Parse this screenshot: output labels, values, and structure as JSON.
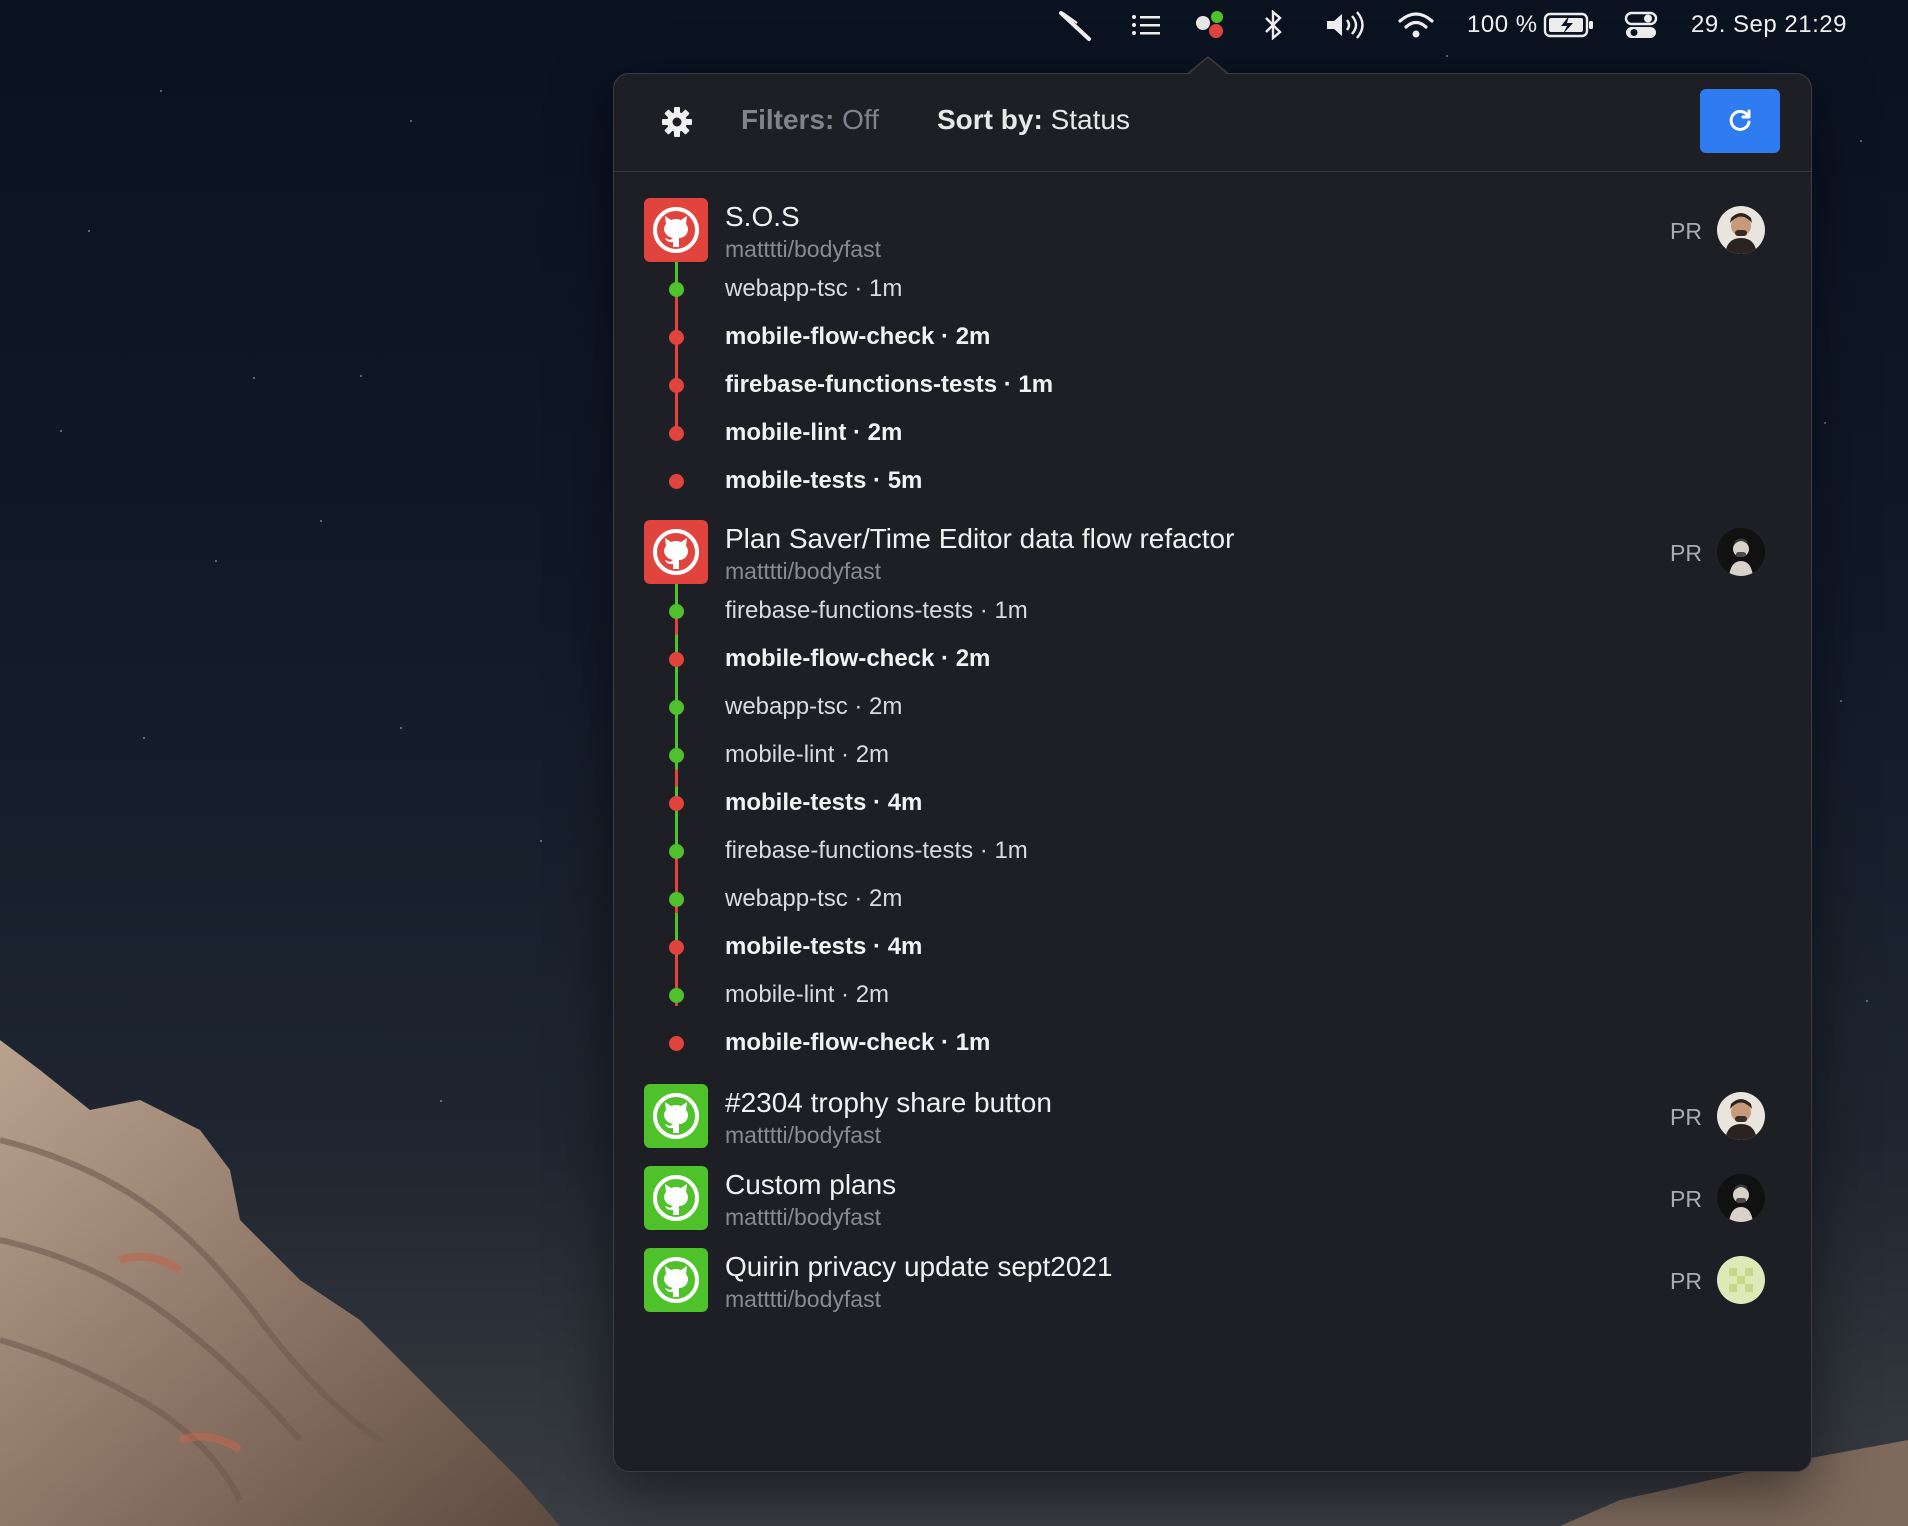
{
  "menubar": {
    "icons": [
      "feather-icon",
      "list-icon",
      "status-dots-icon",
      "bluetooth-icon",
      "volume-icon",
      "wifi-icon",
      "battery-icon",
      "control-center-icon"
    ],
    "battery_label": "100 %",
    "datetime": "29. Sep  21:29"
  },
  "toolbar": {
    "filters_key": "Filters:",
    "filters_value": "Off",
    "sort_key": "Sort by:",
    "sort_value": "Status"
  },
  "colors": {
    "fail": "#e0443d",
    "pass": "#4fc22b",
    "accent": "#2f7bf0"
  },
  "prs": [
    {
      "title": "S.O.S",
      "repo": "matttti/bodyfast",
      "tag": "PR",
      "status": "fail",
      "checks": [
        {
          "label": "webapp-tsc · 1m",
          "status": "pass"
        },
        {
          "label": "mobile-flow-check · 2m",
          "status": "fail"
        },
        {
          "label": "firebase-functions-tests · 1m",
          "status": "fail"
        },
        {
          "label": "mobile-lint · 2m",
          "status": "fail"
        },
        {
          "label": "mobile-tests · 5m",
          "status": "fail"
        }
      ]
    },
    {
      "title": "Plan Saver/Time Editor data flow refactor",
      "repo": "matttti/bodyfast",
      "tag": "PR",
      "status": "fail",
      "checks": [
        {
          "label": "firebase-functions-tests · 1m",
          "status": "pass"
        },
        {
          "label": "mobile-flow-check · 2m",
          "status": "fail"
        },
        {
          "label": "webapp-tsc · 2m",
          "status": "pass"
        },
        {
          "label": "mobile-lint · 2m",
          "status": "pass"
        },
        {
          "label": "mobile-tests · 4m",
          "status": "fail"
        },
        {
          "label": "firebase-functions-tests · 1m",
          "status": "pass"
        },
        {
          "label": "webapp-tsc · 2m",
          "status": "pass"
        },
        {
          "label": "mobile-tests · 4m",
          "status": "fail"
        },
        {
          "label": "mobile-lint · 2m",
          "status": "pass"
        },
        {
          "label": "mobile-flow-check · 1m",
          "status": "fail"
        }
      ]
    },
    {
      "title": "#2304 trophy share button",
      "repo": "matttti/bodyfast",
      "tag": "PR",
      "status": "pass",
      "checks": []
    },
    {
      "title": "Custom plans",
      "repo": "matttti/bodyfast",
      "tag": "PR",
      "status": "pass",
      "checks": []
    },
    {
      "title": "Quirin privacy update sept2021",
      "repo": "matttti/bodyfast",
      "tag": "PR",
      "status": "pass",
      "checks": []
    }
  ]
}
